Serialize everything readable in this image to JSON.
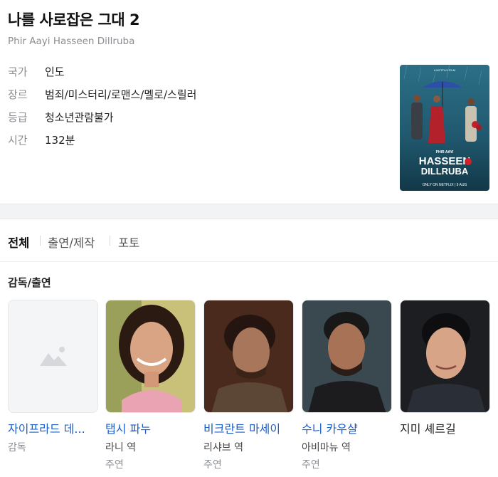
{
  "header": {
    "title": "나를 사로잡은 그대 2",
    "original_title": "Phir Aayi Hasseen Dillruba"
  },
  "info": [
    {
      "key": "국가",
      "value": "인도"
    },
    {
      "key": "장르",
      "value": "범죄/미스터리/로맨스/멜로/스릴러"
    },
    {
      "key": "등급",
      "value": "청소년관람불가"
    },
    {
      "key": "시간",
      "value": "132분"
    }
  ],
  "poster": {
    "top_text": "PHIR AAYI",
    "title_line1": "HASSEEN",
    "title_line2": "DILLRUBA",
    "footer": "ONLY ON NETFLIX | 9 AUG"
  },
  "tabs": [
    {
      "label": "전체",
      "active": true
    },
    {
      "label": "출연/제작",
      "active": false
    },
    {
      "label": "포토",
      "active": false
    }
  ],
  "cast_section": {
    "title": "감독/출연",
    "members": [
      {
        "name": "자이프라드 데사이",
        "name_display": "자이프라드 데...",
        "role": "감독",
        "type": ""
      },
      {
        "name": "탭시 파누",
        "name_display": "탭시 파누",
        "role": "라니 역",
        "type": "주연"
      },
      {
        "name": "비크란트 마세이",
        "name_display": "비크란트 마세이",
        "role": "리샤브 역",
        "type": "주연"
      },
      {
        "name": "수니 카우샬",
        "name_display": "수니 카우샬",
        "role": "아비마뉴 역",
        "type": "주연"
      },
      {
        "name": "지미 셰르길",
        "name_display": "지미 셰르길",
        "role": "",
        "type": ""
      }
    ]
  },
  "colors": {
    "link": "#1a5fc9",
    "muted": "#8a8d91",
    "section_gap": "#f2f3f5"
  }
}
